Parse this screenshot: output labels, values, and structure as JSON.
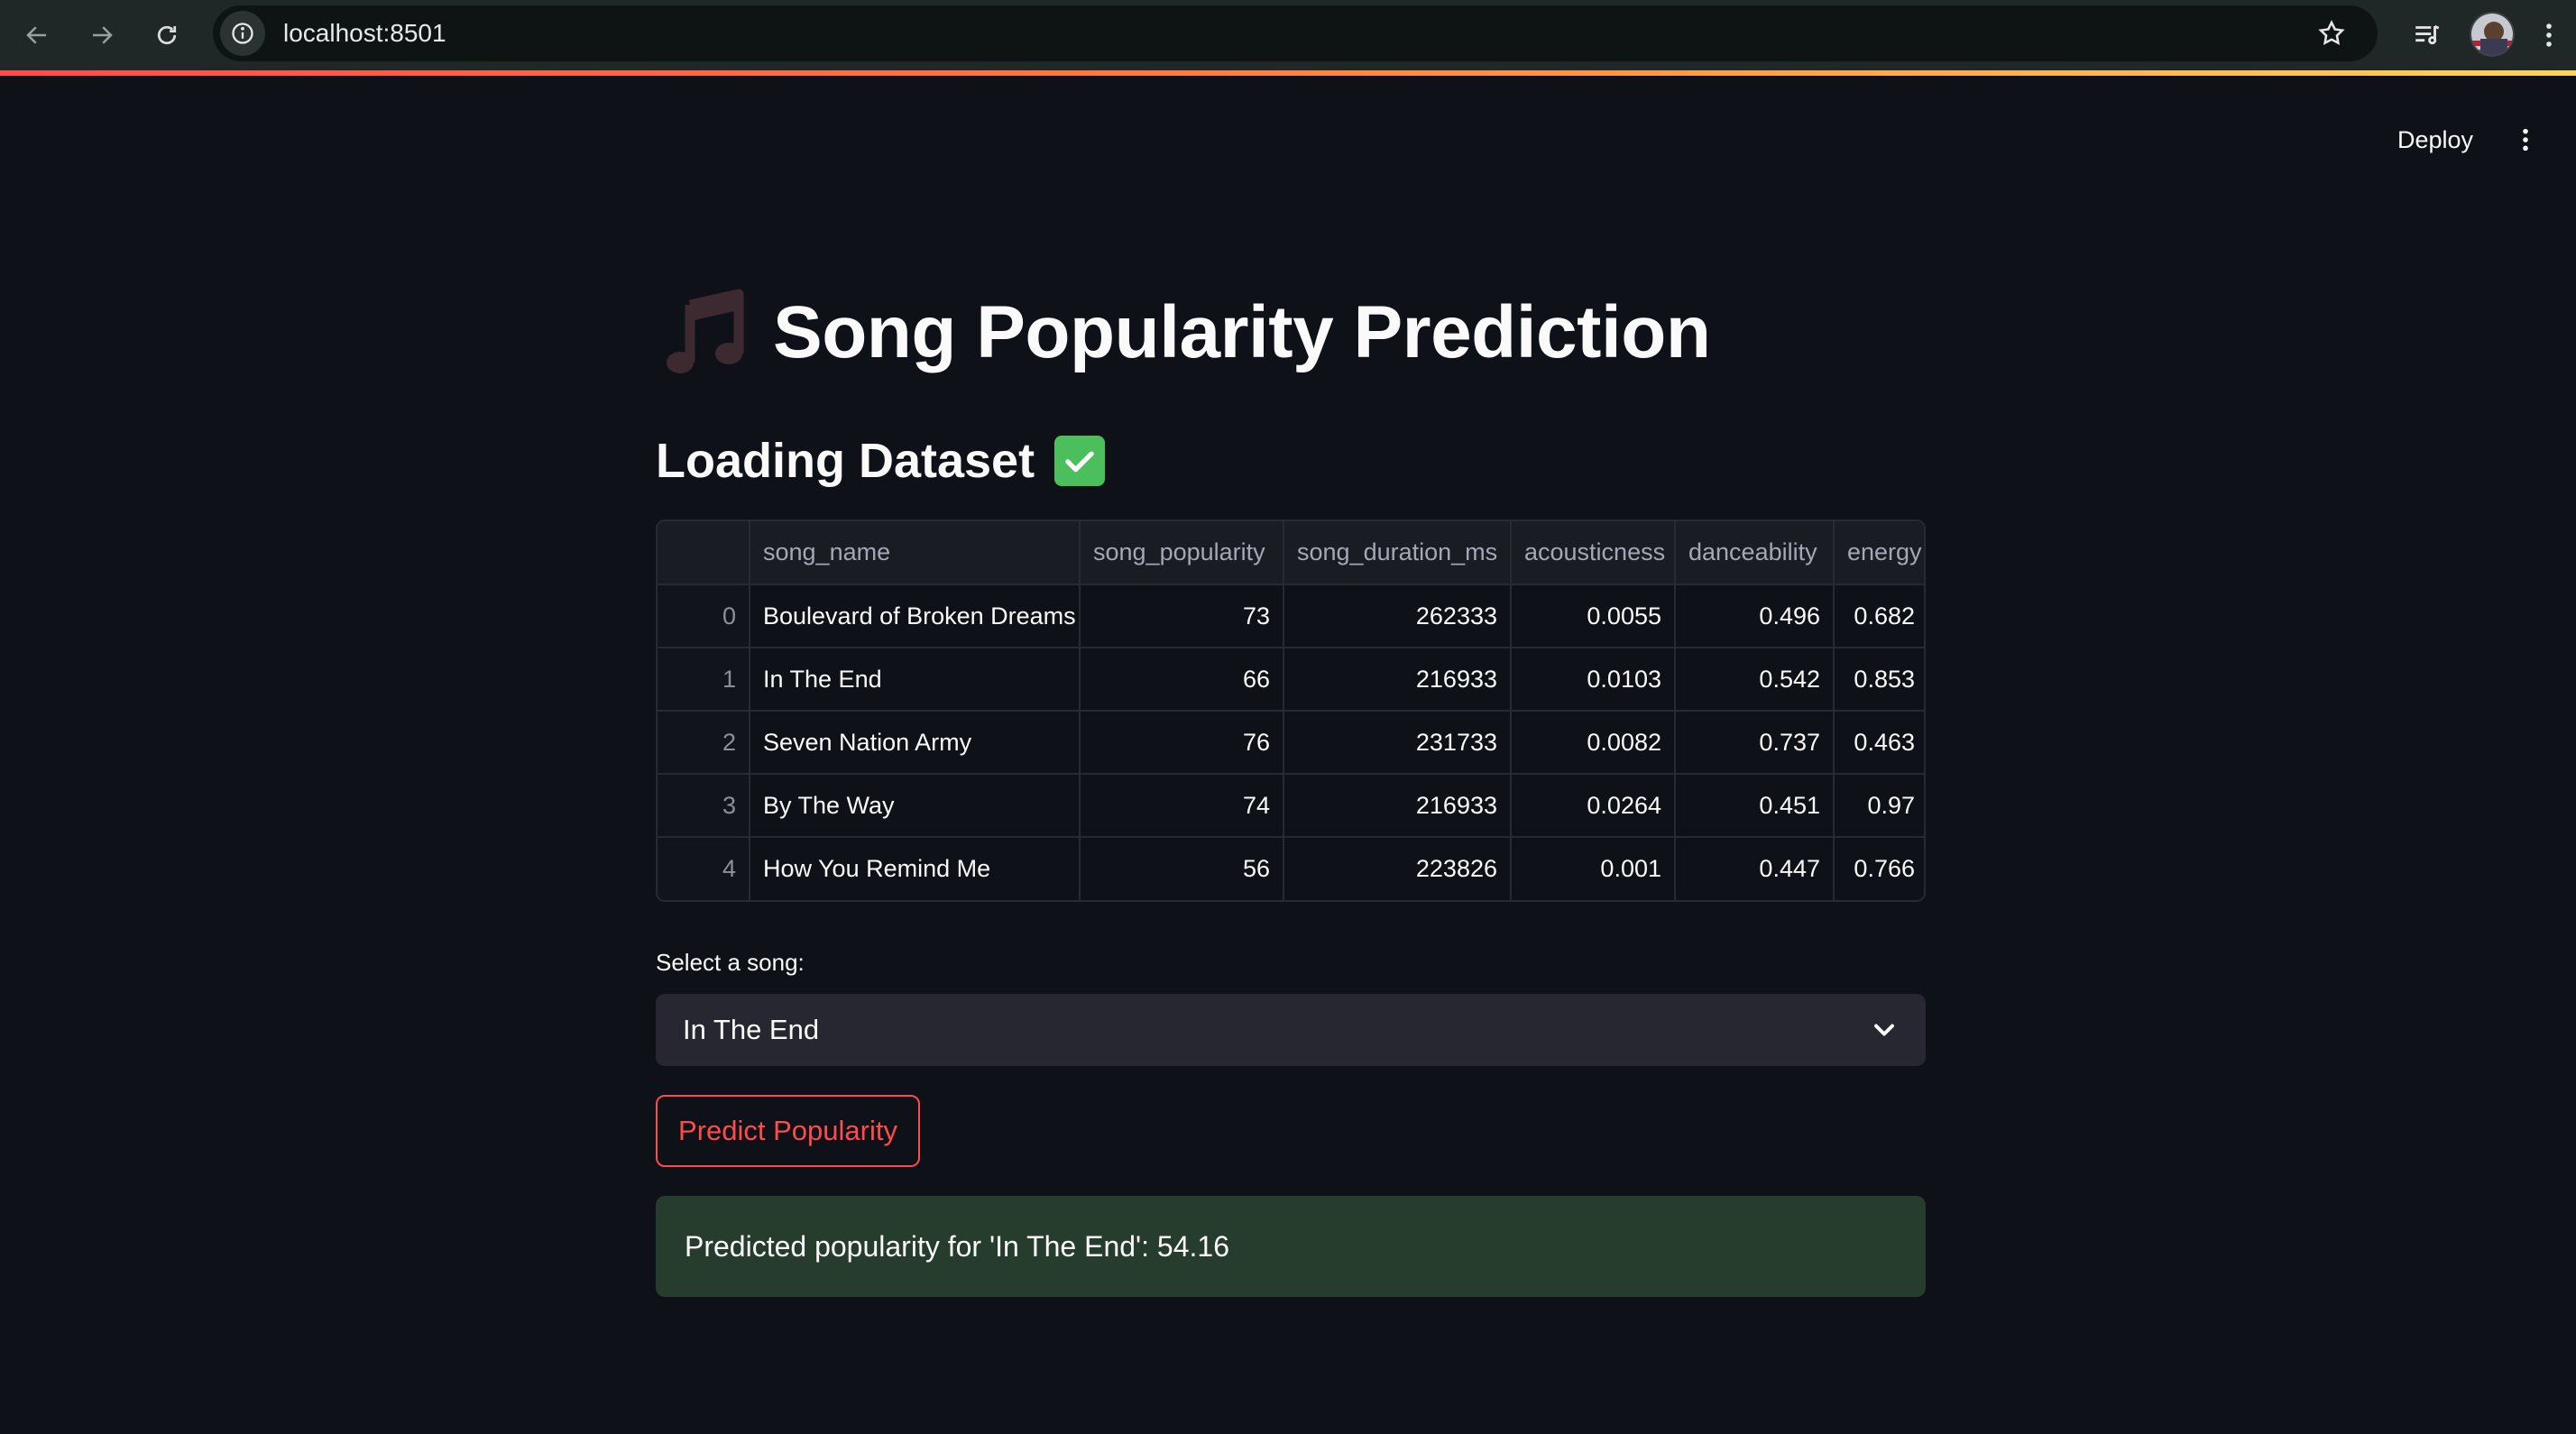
{
  "browser": {
    "url": "localhost:8501"
  },
  "header": {
    "deploy_label": "Deploy"
  },
  "title": {
    "text": "Song Popularity Prediction",
    "icon": "music-note-icon"
  },
  "subheader": {
    "text": "Loading Dataset",
    "icon": "check-mark-icon"
  },
  "dataframe": {
    "columns": [
      "",
      "song_name",
      "song_popularity",
      "song_duration_ms",
      "acousticness",
      "danceability",
      "energy"
    ],
    "rows": [
      [
        "0",
        "Boulevard of Broken Dreams",
        "73",
        "262333",
        "0.0055",
        "0.496",
        "0.682"
      ],
      [
        "1",
        "In The End",
        "66",
        "216933",
        "0.0103",
        "0.542",
        "0.853"
      ],
      [
        "2",
        "Seven Nation Army",
        "76",
        "231733",
        "0.0082",
        "0.737",
        "0.463"
      ],
      [
        "3",
        "By The Way",
        "74",
        "216933",
        "0.0264",
        "0.451",
        "0.97"
      ],
      [
        "4",
        "How You Remind Me",
        "56",
        "223826",
        "0.001",
        "0.447",
        "0.766"
      ]
    ]
  },
  "select": {
    "label": "Select a song:",
    "value": "In The End"
  },
  "predict_button": {
    "label": "Predict Popularity"
  },
  "result": {
    "text": "Predicted popularity for 'In The End': 54.16"
  },
  "colors": {
    "background": "#0e1117",
    "accent": "#ff4b4b",
    "success_bg": "#263d2e",
    "select_bg": "#262730"
  }
}
